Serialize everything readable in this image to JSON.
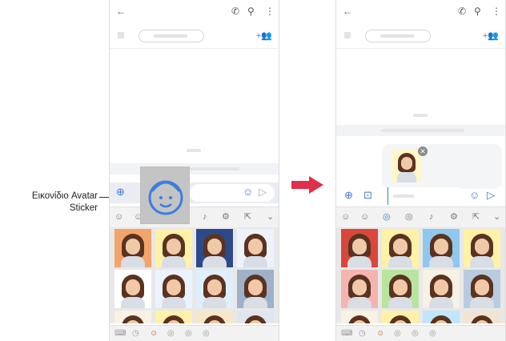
{
  "callout": {
    "line1": "Εικονίδιο Avatar",
    "line2": "Sticker"
  },
  "icons": {
    "back": "←",
    "call": "✆",
    "search": "⚲",
    "more": "⋮",
    "add_person": "+👥",
    "add": "⊕",
    "camera": "⊡",
    "emoji": "☺",
    "send": "▷",
    "remove": "✕",
    "chevron": "⌄",
    "sticker": "☺",
    "gif": "◎",
    "mic": "♪",
    "settings": "⚙",
    "keyboard": "⌨",
    "recent": "◷",
    "resize": "⇱"
  },
  "colors": {
    "accent": "#3a7bd5",
    "arrow": "#e0304a",
    "popup": "#c4c4c4",
    "avatar_outline": "#3b7ee0"
  },
  "stickers": {
    "left_backgrounds": [
      "#f4a36a",
      "#fff2a8",
      "#2c4a8a",
      "#eef3fb",
      "#ffffff",
      "#eaf3ff",
      "#dfefff",
      "#9fb1c8",
      "#f7f2e4",
      "#fff2a8",
      "#f6e7c8",
      "#dfe6ef"
    ],
    "right_backgrounds": [
      "#d9473a",
      "#fff2a8",
      "#8fc7ef",
      "#fff2a8",
      "#f4b5b0",
      "#b8e4a0",
      "#f7f2e4",
      "#b9cbe0",
      "#f7f2e4",
      "#fff2a8",
      "#bfe5ff",
      "#f0e4d4"
    ]
  }
}
